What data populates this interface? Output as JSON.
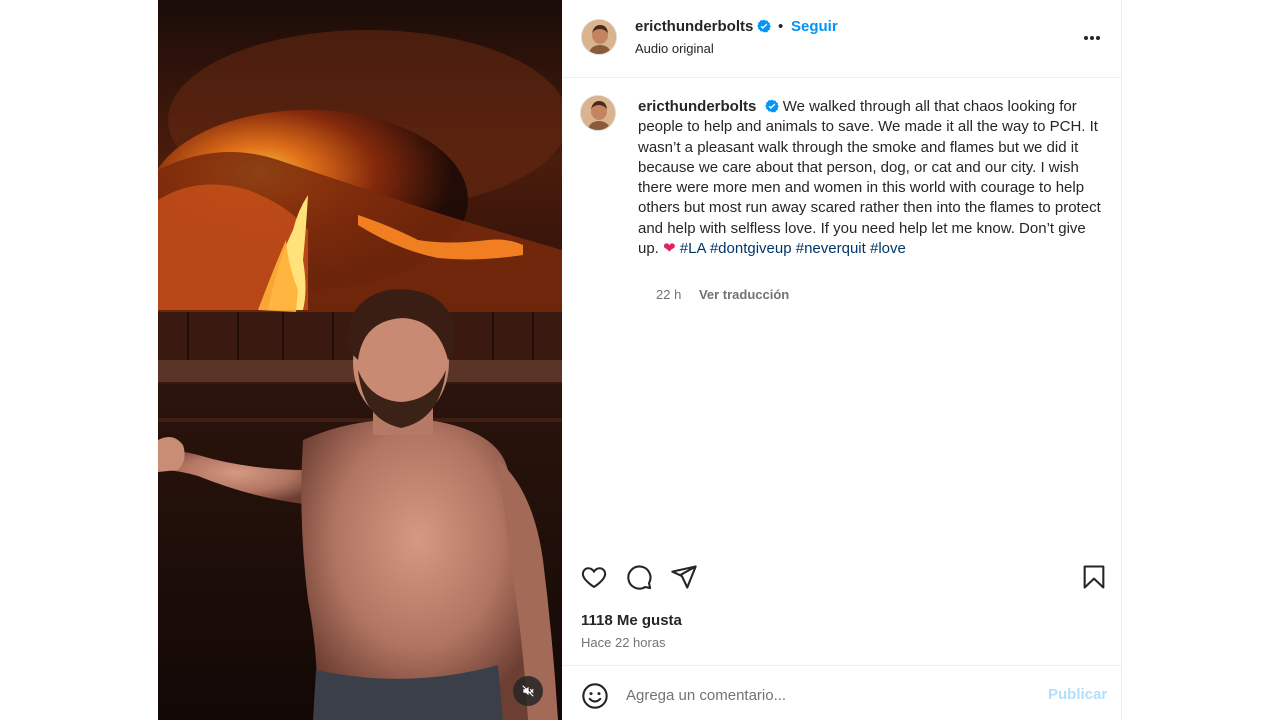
{
  "post": {
    "username": "ericthunderbolts",
    "follow_label": "Seguir",
    "separator": "•",
    "audio_label": "Audio original",
    "caption_text_1": "We walked through all that chaos looking for people to help and animals to save. We made it all the way to PCH. It wasn’t a pleasant walk through the smoke and flames but we did it because we care about that person, dog, or cat and our city. I wish there were more men and women in this world with courage to help others but most run away scared rather then into the flames to protect and help with selfless love. If you need help let me know. Don’t give up.",
    "caption_emoji": "❤",
    "hashtags": [
      "#LA",
      "#dontgiveup",
      "#neverquit",
      "#love"
    ],
    "caption_age": "22 h",
    "translate_label": "Ver traducción",
    "likes_text": "1118 Me gusta",
    "posted_ago": "Hace 22 horas"
  },
  "comment": {
    "placeholder": "Agrega un comentario...",
    "publish_label": "Publicar"
  },
  "icons": {
    "verified": "verified-badge-icon",
    "more": "more-options-icon",
    "like": "heart-icon",
    "comment": "comment-icon",
    "share": "send-icon",
    "save": "bookmark-icon",
    "emoji": "emoji-icon",
    "mute": "speaker-muted-icon"
  },
  "colors": {
    "accent": "#0095f6",
    "hashtag": "#00376b",
    "verified": "#0095f6",
    "publish_disabled": "#b2dffc",
    "secondary_text": "#737373"
  }
}
